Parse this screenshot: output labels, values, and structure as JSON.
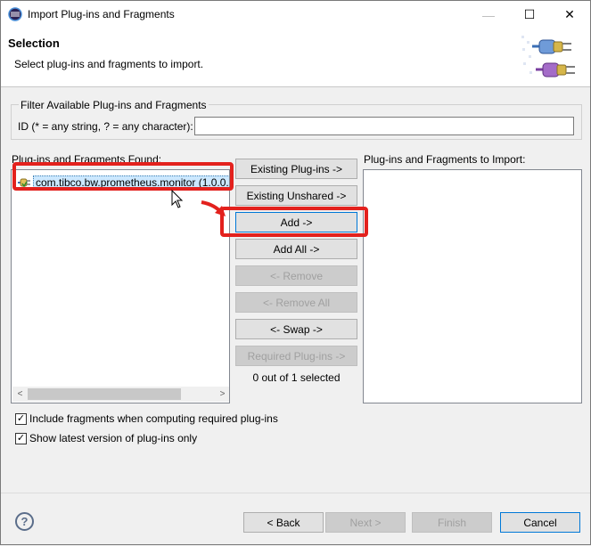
{
  "window": {
    "title": "Import Plug-ins and Fragments",
    "minimize_glyph": "—",
    "maximize_glyph": "☐",
    "close_glyph": "✕"
  },
  "header": {
    "title": "Selection",
    "description": "Select plug-ins and fragments to import."
  },
  "filter": {
    "group_title": "Filter Available Plug-ins and Fragments",
    "id_label": "ID (* = any string, ? = any character):",
    "id_value": ""
  },
  "found": {
    "label": "Plug-ins and Fragments Found:",
    "items": [
      {
        "label": "com.tibco.bw.prometheus.monitor (1.0.0.",
        "selected": true
      }
    ],
    "scroll_left_glyph": "<",
    "scroll_right_glyph": ">"
  },
  "buttons": {
    "existing_plugins": "Existing Plug-ins ->",
    "existing_unshared": "Existing Unshared ->",
    "add": "Add ->",
    "add_all": "Add All ->",
    "remove": "<- Remove",
    "remove_all": "<- Remove All",
    "swap": "<- Swap ->",
    "required_plugins": "Required Plug-ins ->"
  },
  "selection_count": "0 out of 1 selected",
  "to_import": {
    "label": "Plug-ins and Fragments to Import:",
    "items": []
  },
  "options": {
    "include_fragments": {
      "label": "Include fragments when computing required plug-ins",
      "checked": true
    },
    "show_latest": {
      "label": "Show latest version of plug-ins only",
      "checked": true
    }
  },
  "footer": {
    "help_glyph": "?",
    "back": "< Back",
    "next": "Next >",
    "finish": "Finish",
    "cancel": "Cancel"
  },
  "colors": {
    "highlight": "#e3211d",
    "selection_bg": "#cce8ff",
    "focus_border": "#0078d7"
  }
}
